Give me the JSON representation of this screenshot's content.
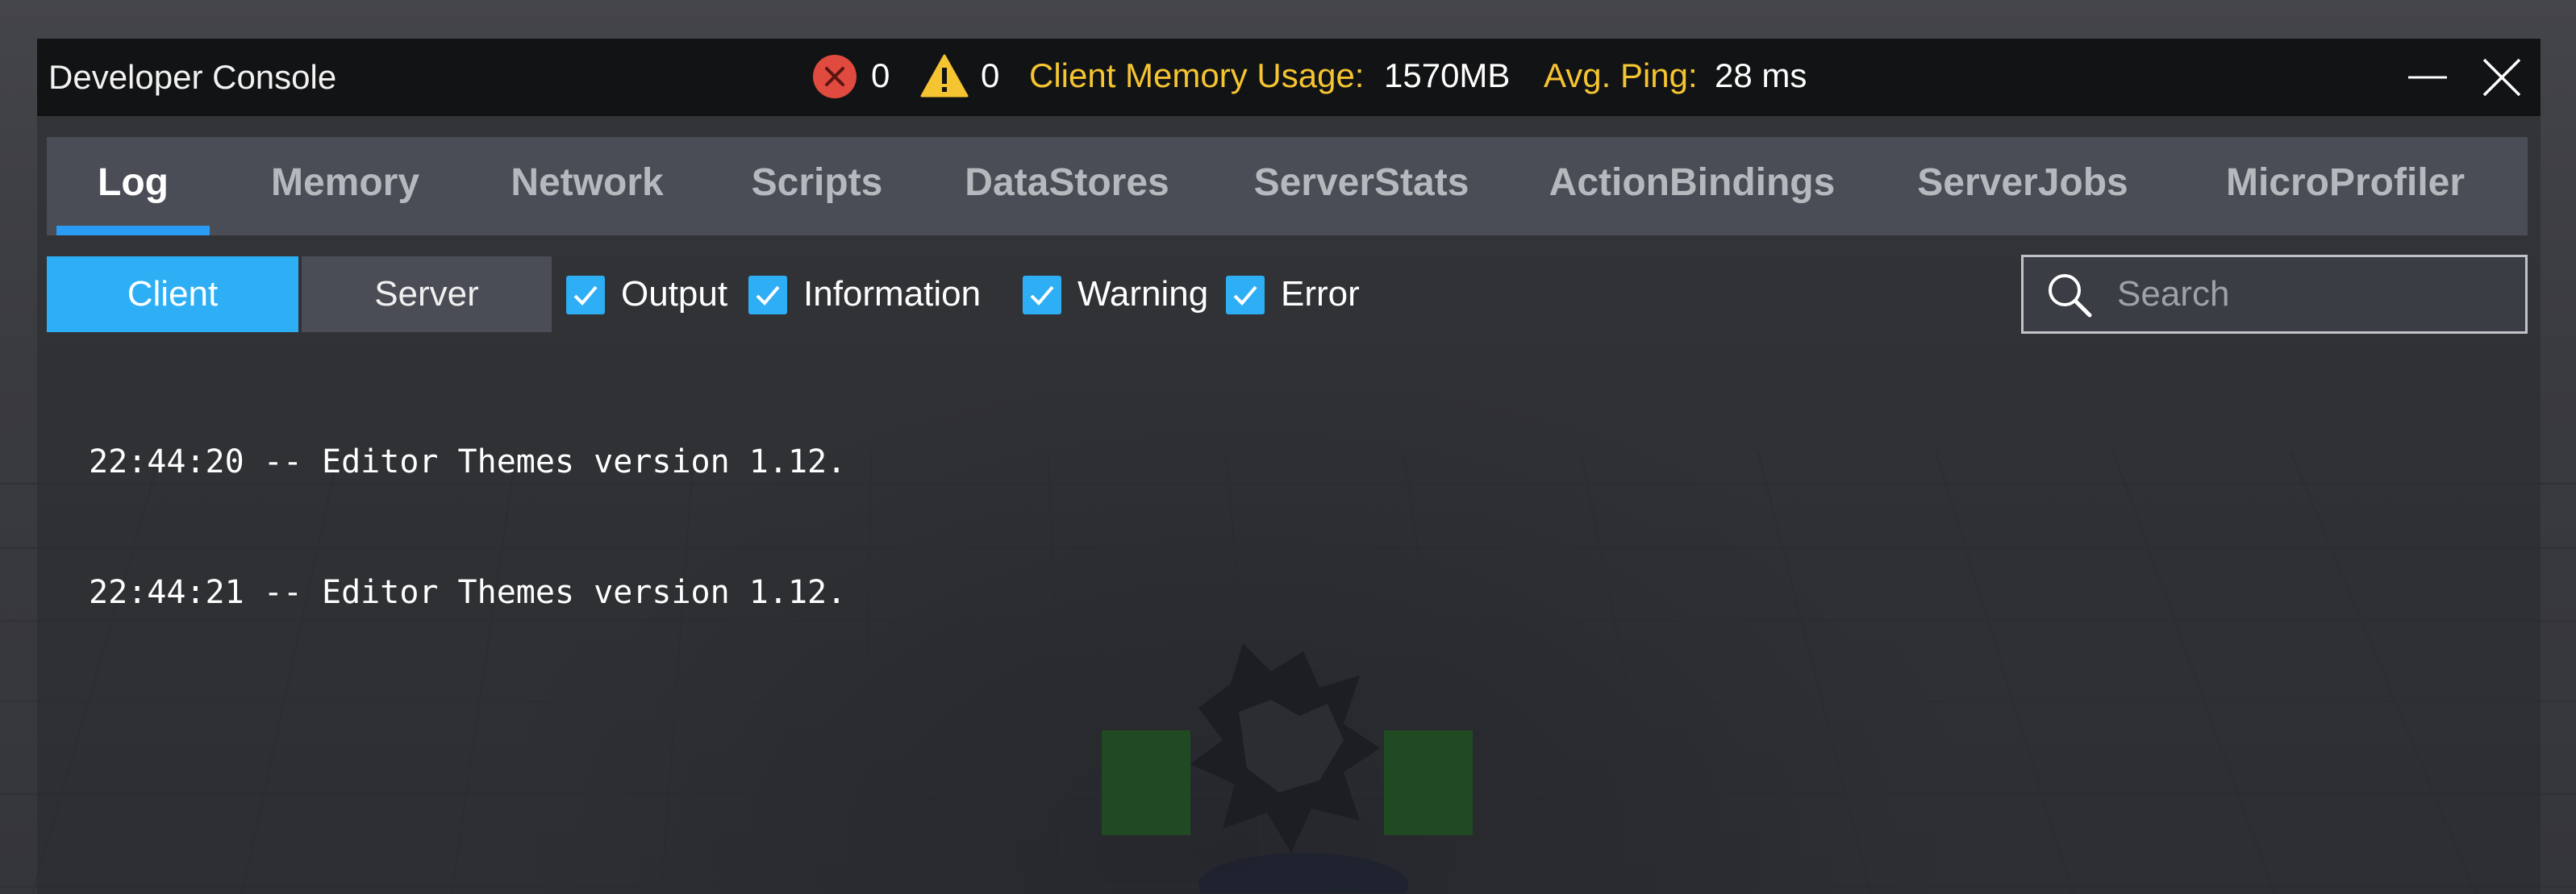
{
  "window": {
    "title": "Developer Console",
    "error_count": "0",
    "warning_count": "0",
    "memory_label": "Client Memory Usage:",
    "memory_value": "1570MB",
    "ping_label": "Avg. Ping:",
    "ping_value": "28 ms",
    "icons": {
      "error": "error-x-circle-icon",
      "warning": "warning-triangle-icon",
      "minimize": "minimize-icon",
      "close": "close-icon"
    },
    "colors": {
      "accent": "#2eaff5",
      "stat_label": "#f5c431",
      "error_icon": "#e04a3f",
      "warning_icon": "#f5c431"
    }
  },
  "tabs": [
    {
      "label": "Log",
      "active": true
    },
    {
      "label": "Memory",
      "active": false
    },
    {
      "label": "Network",
      "active": false
    },
    {
      "label": "Scripts",
      "active": false
    },
    {
      "label": "DataStores",
      "active": false
    },
    {
      "label": "ServerStats",
      "active": false
    },
    {
      "label": "ActionBindings",
      "active": false
    },
    {
      "label": "ServerJobs",
      "active": false
    },
    {
      "label": "MicroProfiler",
      "active": false
    }
  ],
  "scope": {
    "client_label": "Client",
    "server_label": "Server",
    "selected": "Client"
  },
  "filters": [
    {
      "label": "Output",
      "checked": true
    },
    {
      "label": "Information",
      "checked": true
    },
    {
      "label": "Warning",
      "checked": true
    },
    {
      "label": "Error",
      "checked": true
    }
  ],
  "search": {
    "placeholder": "Search",
    "value": ""
  },
  "log_lines": [
    "22:44:20 -- Editor Themes version 1.12.",
    "22:44:21 -- Editor Themes version 1.12."
  ]
}
